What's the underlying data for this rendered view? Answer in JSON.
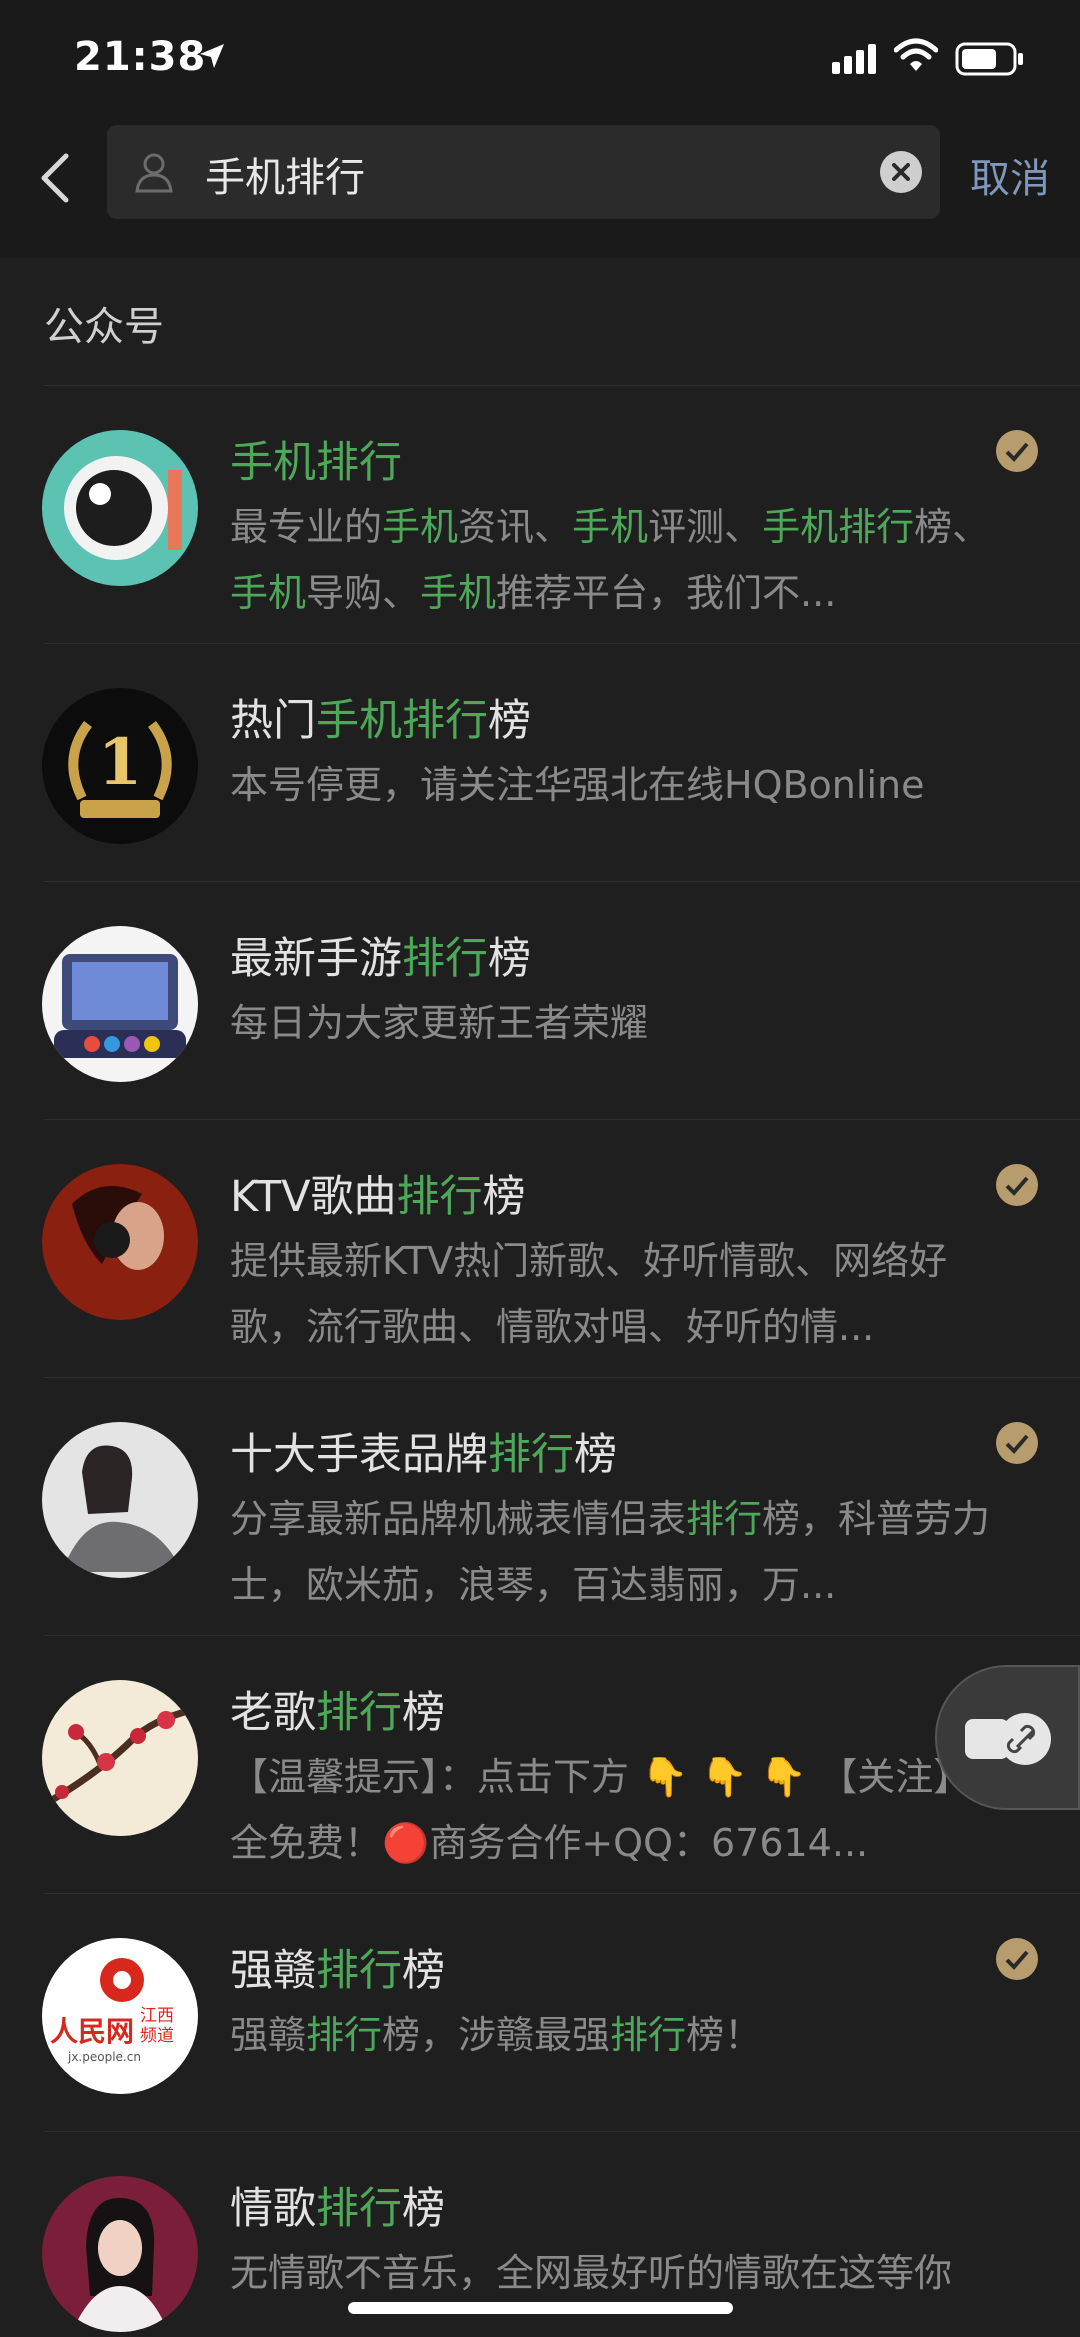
{
  "status_bar": {
    "time": "21:38"
  },
  "search": {
    "query": "手机排行",
    "cancel_label": "取消"
  },
  "section_title": "公众号",
  "results": [
    {
      "title_parts": [
        {
          "t": "手机排行",
          "hl": true
        }
      ],
      "desc_parts": [
        {
          "t": "最专业的",
          "hl": false
        },
        {
          "t": "手机",
          "hl": true
        },
        {
          "t": "资讯、",
          "hl": false
        },
        {
          "t": "手机",
          "hl": true
        },
        {
          "t": "评测、",
          "hl": false
        },
        {
          "t": "手机排行",
          "hl": true
        },
        {
          "t": "榜、",
          "hl": false
        },
        {
          "t": "手机",
          "hl": true
        },
        {
          "t": "导购、",
          "hl": false
        },
        {
          "t": "手机",
          "hl": true
        },
        {
          "t": "推荐平台，我们不...",
          "hl": false
        }
      ],
      "verified": true,
      "avatar_icon": "camera-eye-icon"
    },
    {
      "title_parts": [
        {
          "t": "热门",
          "hl": false
        },
        {
          "t": "手机排行",
          "hl": true
        },
        {
          "t": "榜",
          "hl": false
        }
      ],
      "desc_parts": [
        {
          "t": "本号停更，请关注华强北在线HQBonline",
          "hl": false
        }
      ],
      "verified": false,
      "avatar_icon": "laurel-number-one-icon"
    },
    {
      "title_parts": [
        {
          "t": "最新手游",
          "hl": false
        },
        {
          "t": "排行",
          "hl": true
        },
        {
          "t": "榜",
          "hl": false
        }
      ],
      "desc_parts": [
        {
          "t": "每日为大家更新王者荣耀",
          "hl": false
        }
      ],
      "verified": false,
      "avatar_icon": "arcade-console-icon"
    },
    {
      "title_parts": [
        {
          "t": "KTV歌曲",
          "hl": false
        },
        {
          "t": "排行",
          "hl": true
        },
        {
          "t": "榜",
          "hl": false
        }
      ],
      "desc_parts": [
        {
          "t": "提供最新KTV热门新歌、好听情歌、网络好歌，流行歌曲、情歌对唱、好听的情...",
          "hl": false
        }
      ],
      "verified": true,
      "avatar_icon": "headphones-woman-icon"
    },
    {
      "title_parts": [
        {
          "t": "十大手表品牌",
          "hl": false
        },
        {
          "t": "排行",
          "hl": true
        },
        {
          "t": "榜",
          "hl": false
        }
      ],
      "desc_parts": [
        {
          "t": "分享最新品牌机械表情侣表",
          "hl": false
        },
        {
          "t": "排行",
          "hl": true
        },
        {
          "t": "榜，科普劳力士，欧米茄，浪琴，百达翡丽，万...",
          "hl": false
        }
      ],
      "verified": true,
      "avatar_icon": "woman-portrait-icon"
    },
    {
      "title_parts": [
        {
          "t": "老歌",
          "hl": false
        },
        {
          "t": "排行",
          "hl": true
        },
        {
          "t": "榜",
          "hl": false
        }
      ],
      "desc_parts": [
        {
          "t": "【温馨提示】：点击下方 👇 👇 👇 【关注】完全免费！🔴商务合作+QQ：67614...",
          "hl": false
        }
      ],
      "verified": false,
      "avatar_icon": "plum-blossom-icon"
    },
    {
      "title_parts": [
        {
          "t": "强赣",
          "hl": false
        },
        {
          "t": "排行",
          "hl": true
        },
        {
          "t": "榜",
          "hl": false
        }
      ],
      "desc_parts": [
        {
          "t": "强赣",
          "hl": false
        },
        {
          "t": "排行",
          "hl": true
        },
        {
          "t": "榜，涉赣最强",
          "hl": false
        },
        {
          "t": "排行",
          "hl": true
        },
        {
          "t": "榜！",
          "hl": false
        }
      ],
      "verified": true,
      "avatar_icon": "people-net-jiangxi-logo",
      "avatar_text": {
        "main": "人民网",
        "side1": "江西",
        "side2": "频道",
        "url": "jx.people.cn"
      }
    },
    {
      "title_parts": [
        {
          "t": "情歌",
          "hl": false
        },
        {
          "t": "排行",
          "hl": true
        },
        {
          "t": "榜",
          "hl": false
        }
      ],
      "desc_parts": [
        {
          "t": "无情歌不音乐，全网最好听的情歌在这等你",
          "hl": false
        }
      ],
      "verified": false,
      "avatar_icon": "singer-portrait-icon"
    }
  ],
  "colors": {
    "highlight": "#4ea85a",
    "cancel": "#7f97bb",
    "verified": "#b79d6e",
    "background": "#1f1f1f"
  }
}
